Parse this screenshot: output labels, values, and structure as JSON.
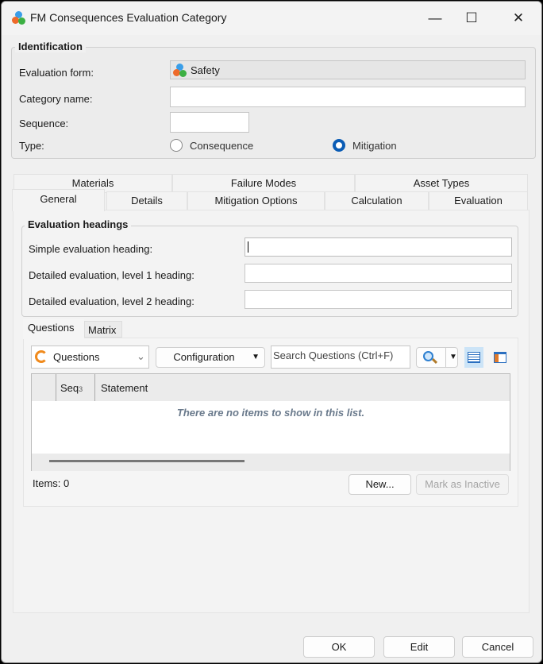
{
  "window": {
    "title": "FM Consequences Evaluation Category",
    "minimize": "—",
    "maximize": "☐",
    "close": "✕"
  },
  "identification": {
    "legend": "Identification",
    "evaluation_form_label": "Evaluation form:",
    "evaluation_form_value": "Safety",
    "category_name_label": "Category name:",
    "category_name_value": "",
    "sequence_label": "Sequence:",
    "sequence_value": "",
    "type_label": "Type:",
    "type_options": [
      "Consequence",
      "Mitigation"
    ],
    "type_selected": "Mitigation"
  },
  "tabs": {
    "row1": [
      "Materials",
      "Failure Modes",
      "Asset Types"
    ],
    "row2": [
      "General",
      "Details",
      "Mitigation Options",
      "Calculation",
      "Evaluation"
    ],
    "active": "General"
  },
  "headings": {
    "legend": "Evaluation headings",
    "simple_label": "Simple evaluation  heading:",
    "level1_label": "Detailed evaluation, level 1 heading:",
    "level2_label": "Detailed evaluation, level 2 heading:"
  },
  "inner_tabs": [
    "Questions",
    "Matrix"
  ],
  "toolbar": {
    "view_select": "Questions",
    "configuration": "Configuration",
    "search_placeholder": "Search Questions  (Ctrl+F)"
  },
  "grid": {
    "columns": [
      "Seq",
      "Statement"
    ],
    "sort_indicator": "3",
    "empty_text": "There are no items to show in this list."
  },
  "footer": {
    "items_count": "Items: 0",
    "new": "New...",
    "mark_inactive": "Mark as Inactive"
  },
  "buttons": {
    "ok": "OK",
    "edit": "Edit",
    "cancel": "Cancel"
  }
}
